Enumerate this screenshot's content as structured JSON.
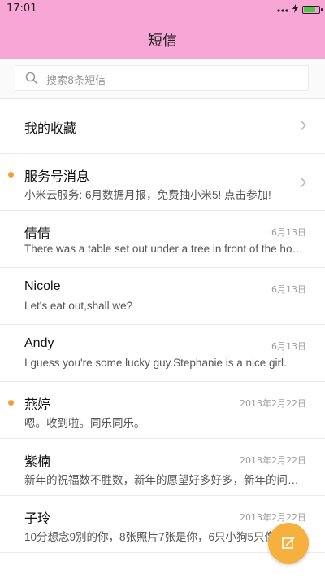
{
  "status_bar": {
    "time": "17:01",
    "battery_level": 0.85,
    "battery_color": "#53c44b"
  },
  "header": {
    "title": "短信",
    "background": "#f8a6d6"
  },
  "search": {
    "placeholder": "搜索8条短信"
  },
  "favorites": {
    "label": "我的收藏"
  },
  "conversations": [
    {
      "name": "服务号消息",
      "preview": "小米云服务: 6月数据月报，免费抽小米5! 点击参加!",
      "date": "",
      "unread": true,
      "chevron": true
    },
    {
      "name": "倩倩",
      "preview": "There was a table set out under a tree in front of the house...",
      "date": "6月13日",
      "unread": false,
      "chevron": false
    },
    {
      "name": "Nicole",
      "preview": "Let's eat out,shall we?",
      "date": "6月13日",
      "unread": false,
      "chevron": false
    },
    {
      "name": "Andy",
      "preview": "I guess you're some lucky guy.Stephanie is a nice girl.",
      "date": "6月13日",
      "unread": false,
      "chevron": false
    },
    {
      "name": "燕婷",
      "preview": "嗯。收到啦。同乐同乐。",
      "date": "2013年2月22日",
      "unread": true,
      "chevron": false
    },
    {
      "name": "紫楠",
      "preview": "新年的祝福数不胜数，新年的愿望好多好多，新年的问候...",
      "date": "2013年2月22日",
      "unread": false,
      "chevron": false
    },
    {
      "name": "子玲",
      "preview": "10分想念9别的你，8张照片7张是你，6只小狗5只像你",
      "date": "2013年2月22日",
      "unread": false,
      "chevron": false
    }
  ],
  "fab": {
    "icon": "compose-icon",
    "color": "#f6b03d"
  },
  "colors": {
    "unread_dot": "#f0a23a"
  }
}
